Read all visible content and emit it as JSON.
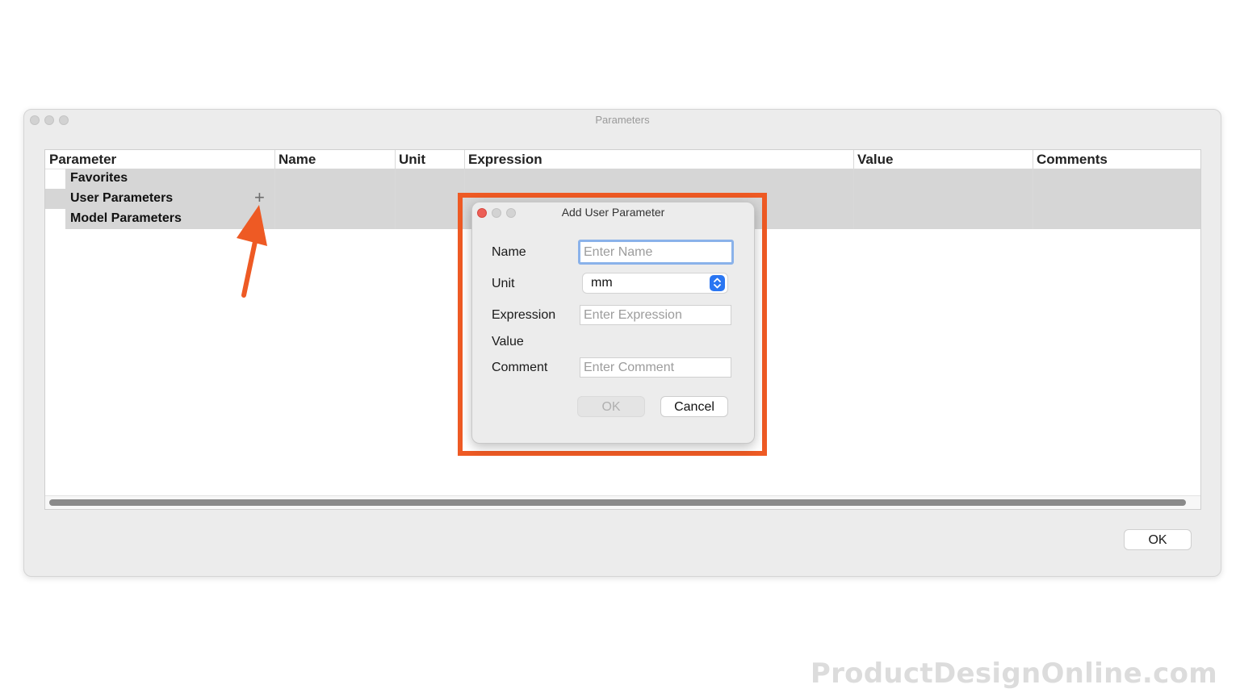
{
  "window": {
    "title": "Parameters",
    "ok_label": "OK"
  },
  "table": {
    "columns": [
      "Parameter",
      "Name",
      "Unit",
      "Expression",
      "Value",
      "Comments"
    ],
    "rows": [
      {
        "label": "Favorites"
      },
      {
        "label": "User Parameters",
        "action_icon": "plus-icon"
      },
      {
        "label": "Model Parameters"
      }
    ]
  },
  "dialog": {
    "title": "Add User Parameter",
    "fields": {
      "name_label": "Name",
      "name_placeholder": "Enter Name",
      "unit_label": "Unit",
      "unit_value": "mm",
      "expression_label": "Expression",
      "expression_placeholder": "Enter Expression",
      "value_label": "Value",
      "comment_label": "Comment",
      "comment_placeholder": "Enter Comment"
    },
    "ok_label": "OK",
    "cancel_label": "Cancel"
  },
  "annotation": {
    "highlight_color": "#ee5a24",
    "arrow_color": "#ee5a24"
  },
  "watermark": "ProductDesignOnline.com"
}
